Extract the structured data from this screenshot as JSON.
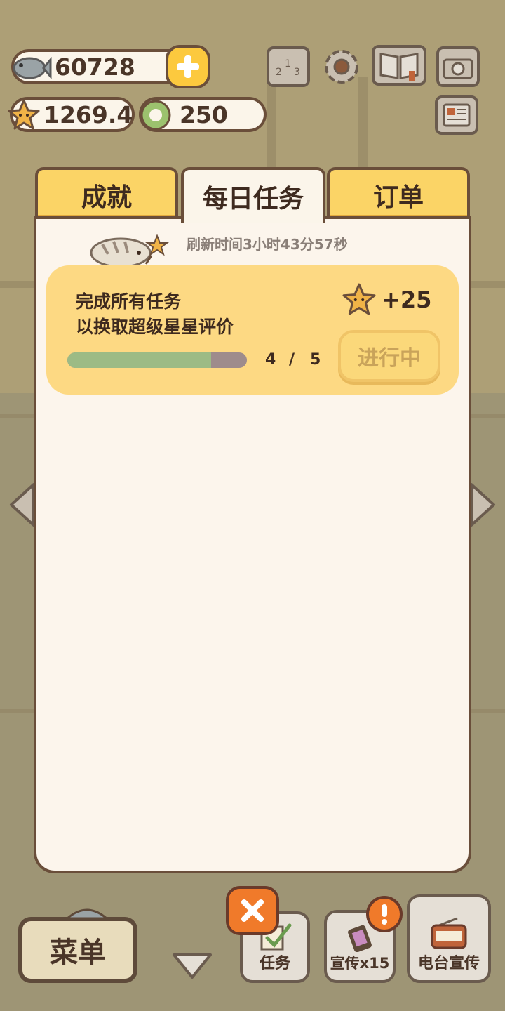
{
  "resources": {
    "fish": "60728",
    "stars": "1269.4",
    "gems": "250"
  },
  "tabs": [
    "成就",
    "每日任务",
    "订单"
  ],
  "refresh_text": "刷新时间3小时43分57秒",
  "task": {
    "line1": "完成所有任务",
    "line2": "以换取超级星星评价",
    "progress": 0.8,
    "current": "4",
    "separator": "/",
    "total": "5",
    "reward": "+25",
    "status": "进行中"
  },
  "bottom": {
    "menu": "菜单",
    "task": "任务",
    "promo": "宣传x15",
    "radio": "电台宣传"
  },
  "colors": {
    "tab_yellow": "#fbd466",
    "panel": "#fcf5ec",
    "card": "#fdd983",
    "progress_fill": "#9cbb85",
    "close_orange": "#f07a2a"
  }
}
